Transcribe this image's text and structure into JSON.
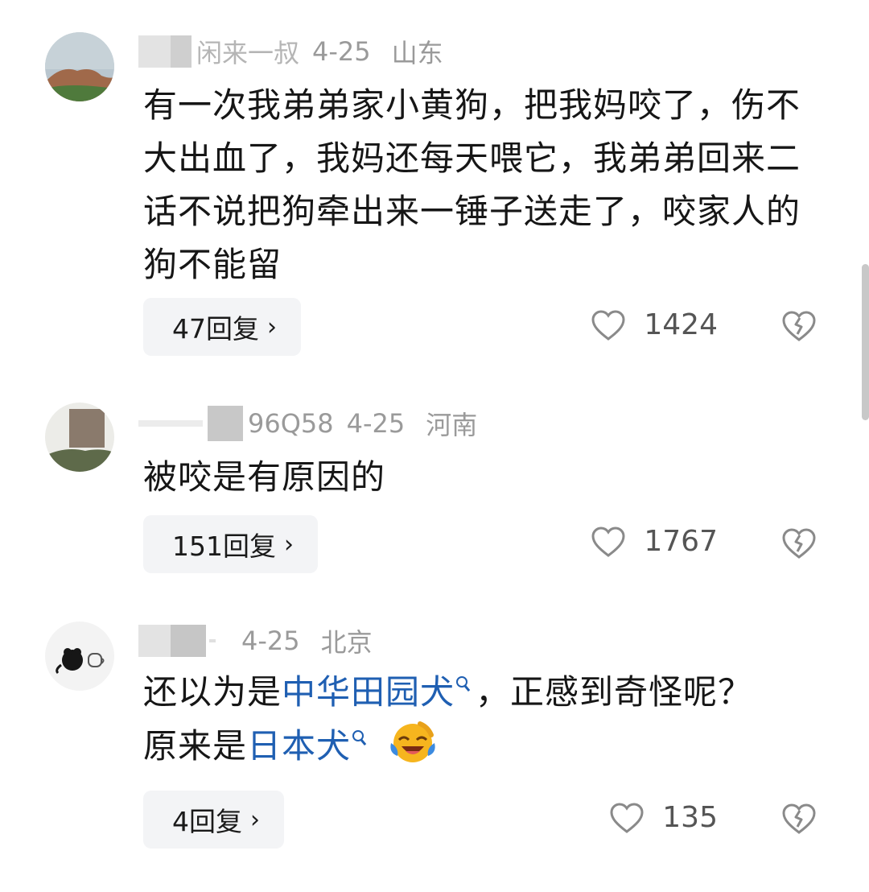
{
  "comments": [
    {
      "name_visible": "闲来一叔",
      "date": "4-25",
      "location": "山东",
      "text": "有一次我弟弟家小黄狗，把我妈咬了，伤不大出血了，我妈还每天喂它，我弟弟回来二话不说把狗牵出来一锤子送走了，咬家人的狗不能留",
      "replies": "47回复",
      "likes": "1424"
    },
    {
      "name_visible": "96Q58",
      "date": "4-25",
      "location": "河南",
      "text": "被咬是有原因的",
      "replies": "151回复",
      "likes": "1767"
    },
    {
      "name_visible": "",
      "date": "4-25",
      "location": "北京",
      "text_parts": [
        "还以为是",
        "中华田园犬",
        "，正感到奇怪呢？原来是",
        "日本犬"
      ],
      "emoji": "face-with-tears-of-joy",
      "replies": "4回复",
      "likes": "135"
    }
  ],
  "ui": {
    "chevron": "›",
    "like_icon": "heart-outline-icon",
    "dislike_icon": "broken-heart-icon",
    "link_color": "#1f5fb2"
  }
}
